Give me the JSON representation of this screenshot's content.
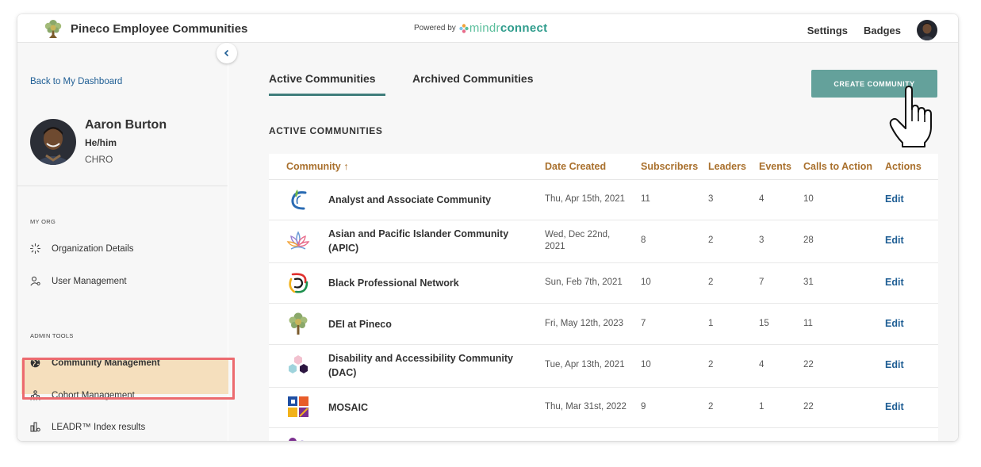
{
  "header": {
    "app_name": "Pineco Employee Communities",
    "powered_by": "Powered by",
    "brand_mindr": "mindr",
    "brand_connect": "connect",
    "links": [
      "Settings",
      "Badges"
    ]
  },
  "sidebar": {
    "back_link": "Back to My Dashboard",
    "profile": {
      "name": "Aaron Burton",
      "pronouns": "He/him",
      "title": "CHRO"
    },
    "sections": [
      {
        "label": "MY ORG",
        "items": [
          "Organization Details",
          "User Management"
        ]
      },
      {
        "label": "ADMIN TOOLS",
        "items": [
          "Community Management",
          "Cohort Management",
          "LEADR™ Index results"
        ]
      }
    ],
    "active_item": "Community Management"
  },
  "main": {
    "tabs": [
      "Active Communities",
      "Archived Communities"
    ],
    "active_tab": "Active Communities",
    "create_button": "CREATE COMMUNITY",
    "section_heading": "ACTIVE COMMUNITIES",
    "columns": [
      "Community ↑",
      "Date Created",
      "Subscribers",
      "Leaders",
      "Events",
      "Calls to Action",
      "Actions"
    ],
    "rows": [
      {
        "name": "Analyst and Associate Community",
        "date": "Thu, Apr 15th, 2021",
        "subscribers": "11",
        "leaders": "3",
        "events": "4",
        "calls": "10",
        "action": "Edit",
        "logo": "swirl-logo"
      },
      {
        "name": "Asian and Pacific Islander Community (APIC)",
        "date": "Wed, Dec 22nd, 2021",
        "subscribers": "8",
        "leaders": "2",
        "events": "3",
        "calls": "28",
        "action": "Edit",
        "logo": "lotus-logo"
      },
      {
        "name": "Black Professional Network",
        "date": "Sun, Feb 7th, 2021",
        "subscribers": "10",
        "leaders": "2",
        "events": "7",
        "calls": "31",
        "action": "Edit",
        "logo": "knot-logo"
      },
      {
        "name": "DEI at Pineco",
        "date": "Fri, May 12th, 2023",
        "subscribers": "7",
        "leaders": "1",
        "events": "15",
        "calls": "11",
        "action": "Edit",
        "logo": "tree-logo"
      },
      {
        "name": "Disability and Accessibility Community (DAC)",
        "date": "Tue, Apr 13th, 2021",
        "subscribers": "10",
        "leaders": "2",
        "events": "4",
        "calls": "22",
        "action": "Edit",
        "logo": "hexagons-logo"
      },
      {
        "name": "MOSAIC",
        "date": "Thu, Mar 31st, 2022",
        "subscribers": "9",
        "leaders": "2",
        "events": "1",
        "calls": "22",
        "action": "Edit",
        "logo": "mosaic-logo"
      }
    ]
  },
  "colors": {
    "accent_teal": "#64a19b",
    "header_gold": "#a9702d",
    "link_blue": "#1f5e94",
    "active_nav_bg": "#f5dfbd",
    "highlight_red": "#ec6a6f"
  }
}
